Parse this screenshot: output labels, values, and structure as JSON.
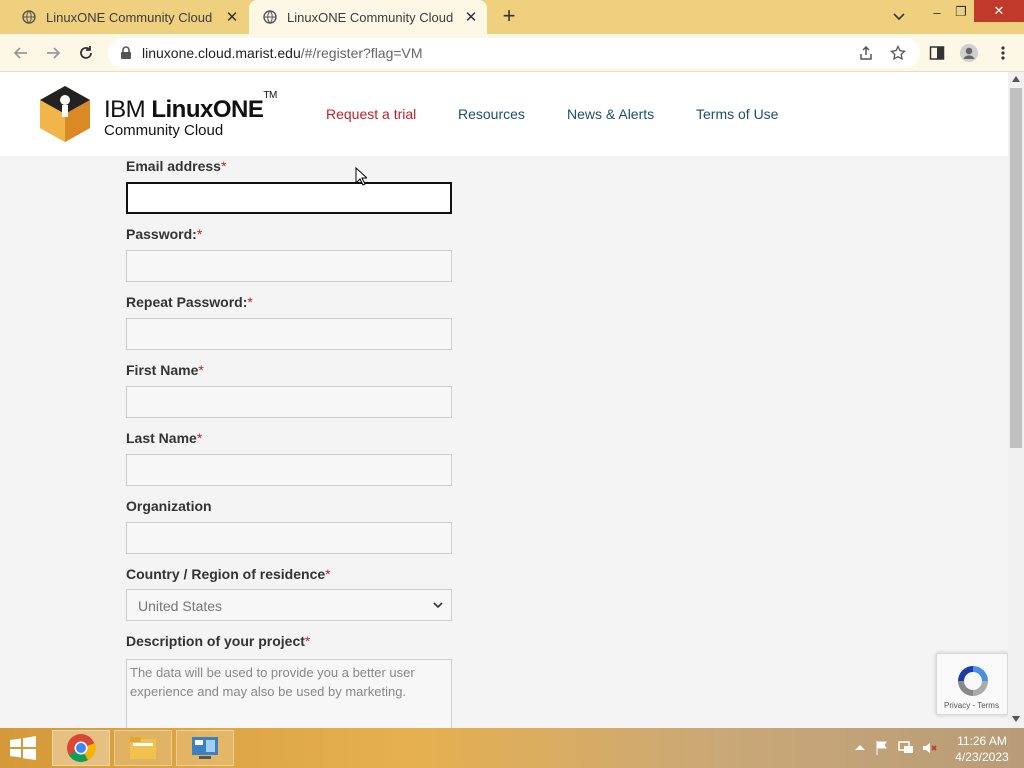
{
  "browser": {
    "tabs": [
      {
        "title": "LinuxONE Community Cloud",
        "active": false
      },
      {
        "title": "LinuxONE Community Cloud",
        "active": true
      }
    ],
    "url_host": "linuxone.cloud.marist.edu",
    "url_path": "/#/register?flag=VM"
  },
  "site": {
    "logo_line1_light": "IBM ",
    "logo_line1_bold": "LinuxONE",
    "logo_tm": "TM",
    "logo_line2": "Community Cloud",
    "nav": [
      {
        "label": "Request a trial",
        "active": true
      },
      {
        "label": "Resources",
        "active": false
      },
      {
        "label": "News & Alerts",
        "active": false
      },
      {
        "label": "Terms of Use",
        "active": false
      }
    ]
  },
  "form": {
    "required_marker": "*",
    "email_label": "Email address",
    "password_label": "Password:",
    "repeat_password_label": "Repeat Password:",
    "first_name_label": "First Name",
    "last_name_label": "Last Name",
    "organization_label": "Organization",
    "country_label": "Country / Region of residence",
    "country_value": "United States",
    "description_label": "Description of your project",
    "description_placeholder": "The data will be used to provide you a better user experience and may also be used by marketing."
  },
  "recaptcha": {
    "text": "Privacy - Terms"
  },
  "taskbar": {
    "time": "11:26 AM",
    "date": "4/23/2023"
  },
  "colors": {
    "accent_red": "#c21f2b",
    "nav_blue": "#1f4e6b",
    "tab_strip": "#efd07f"
  }
}
